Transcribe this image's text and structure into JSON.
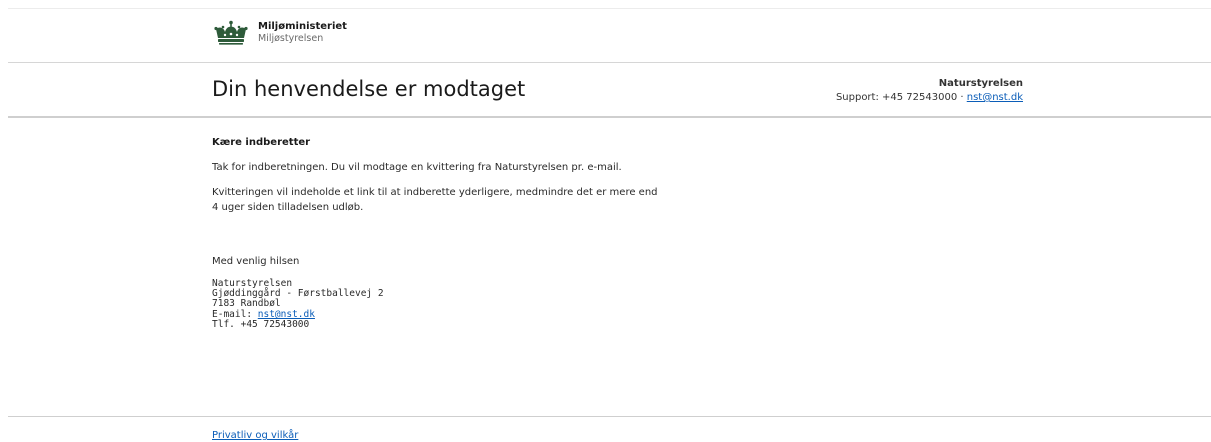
{
  "brand": {
    "ministry": "Miljøministeriet",
    "agency": "Miljøstyrelsen"
  },
  "header": {
    "title": "Din henvendelse er modtaget",
    "contact_org": "Naturstyrelsen",
    "support_prefix": "Support: +45 72543000 · ",
    "support_email": "nst@nst.dk"
  },
  "message": {
    "greeting": "Kære indberetter",
    "para1": "Tak for indberetningen. Du vil modtage en kvittering fra Naturstyrelsen pr. e-mail.",
    "para2_line1": "Kvitteringen vil indeholde et link til at indberette yderligere, medmindre det er mere end",
    "para2_line2": "4 uger siden tilladelsen udløb.",
    "closing": "Med venlig hilsen"
  },
  "signature": {
    "org": "Naturstyrelsen",
    "address": "Gjøddinggård - Førstballevej 2",
    "city": "7183 Randbøl",
    "email_prefix": "E-mail: ",
    "email": "nst@nst.dk",
    "phone": "Tlf. +45 72543000"
  },
  "footer": {
    "privacy_link": "Privatliv og vilkår"
  },
  "colors": {
    "link": "#0b5db8",
    "logo_green": "#2e5b3a"
  },
  "icons": {
    "logo": "crown-icon"
  }
}
